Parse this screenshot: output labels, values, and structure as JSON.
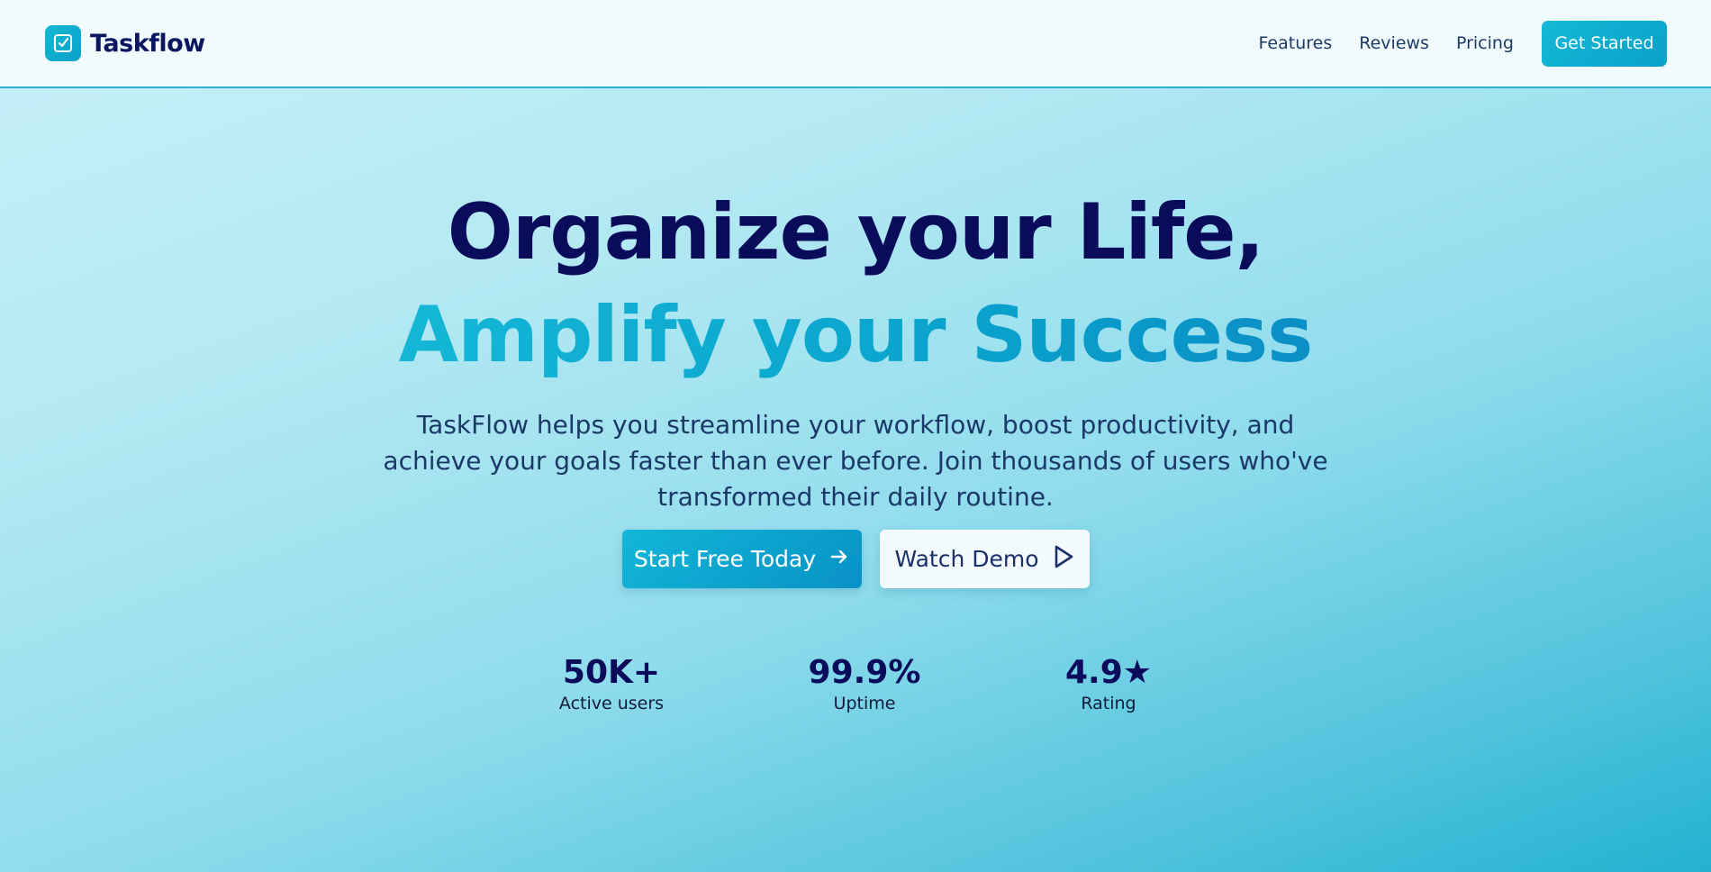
{
  "header": {
    "brand": "Taskflow",
    "nav": [
      "Features",
      "Reviews",
      "Pricing"
    ],
    "cta_label": "Get Started"
  },
  "hero": {
    "title_line1": "Organize your Life,",
    "title_line2": "Amplify your Success",
    "subtitle": "TaskFlow helps you streamline your workflow, boost productivity, and achieve your goals faster than ever before. Join thousands of users who've transformed their daily routine.",
    "primary_button": "Start Free Today",
    "secondary_button": "Watch Demo"
  },
  "stats": [
    {
      "value": "50K+",
      "label": "Active users"
    },
    {
      "value": "99.9%",
      "label": "Uptime"
    },
    {
      "value": "4.9★",
      "label": "Rating"
    }
  ],
  "colors": {
    "brand_navy": "#0b0b5c",
    "accent_cyan": "#0ba9d0",
    "header_bg": "#f1fafd"
  },
  "icons": {
    "logo": "checkbox-icon",
    "primary_button": "arrow-right-icon",
    "secondary_button": "play-icon"
  }
}
